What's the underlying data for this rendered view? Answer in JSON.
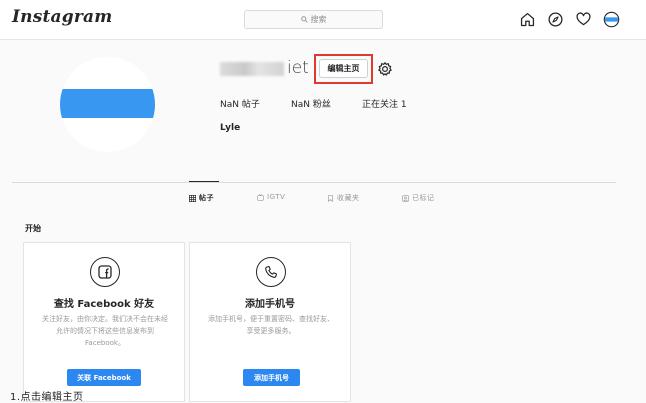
{
  "nav": {
    "logo": "Instagram",
    "search_placeholder": "搜索",
    "icons": [
      "home-icon",
      "explore-icon",
      "heart-icon",
      "profile-avatar-icon"
    ]
  },
  "profile": {
    "username_visible": "iet",
    "edit_button": "编辑主页",
    "posts": "NaN 帖子",
    "followers": "NaN 粉丝",
    "following": "正在关注 1",
    "full_name": "Lyle"
  },
  "tabs": [
    {
      "label": "帖子",
      "icon": "grid-icon",
      "active": true
    },
    {
      "label": "IGTV",
      "icon": "igtv-icon",
      "active": false
    },
    {
      "label": "收藏夹",
      "icon": "bookmark-icon",
      "active": false
    },
    {
      "label": "已标记",
      "icon": "tag-icon",
      "active": false
    }
  ],
  "getting_started": {
    "title": "开始",
    "cards": [
      {
        "icon": "facebook-icon",
        "title": "查找 Facebook 好友",
        "description": "关注好友，由你决定。我们决不会在未经允许的情况下将这些信息发布到 Facebook。",
        "button": "关联 Facebook"
      },
      {
        "icon": "phone-icon",
        "title": "添加手机号",
        "description": "添加手机号，便于重置密码、查找好友、享受更多服务。",
        "button": "添加手机号"
      }
    ]
  },
  "caption": "1.点击编辑主页",
  "colors": {
    "accent": "#2d87f0",
    "highlight": "#e03a2f",
    "avatar": "#3897f0"
  }
}
